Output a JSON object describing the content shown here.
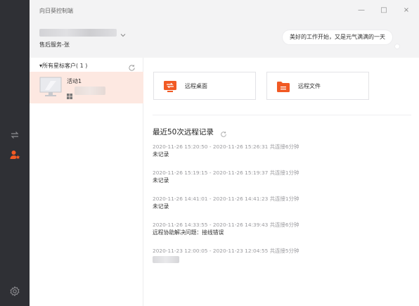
{
  "window": {
    "title": "向日葵控制端",
    "controls": {
      "minimize": "—",
      "maximize": "□",
      "close": "×"
    }
  },
  "account": {
    "role": "售后服务-张",
    "greeting": "美好的工作开始，又是元气满满的一天"
  },
  "sidebar": {
    "icons": [
      "remote-connect-icon",
      "customer-group-icon",
      "settings-icon"
    ],
    "active_color": "#f15a24",
    "inactive_color": "#8c8c90"
  },
  "device_list": {
    "group_label": "▾所有星标客户( 1 )",
    "devices": [
      {
        "name": "活动1",
        "os_icon": "windows-icon"
      }
    ]
  },
  "actions": [
    {
      "label": "远程桌面",
      "icon": "remote-desktop-icon"
    },
    {
      "label": "远程文件",
      "icon": "remote-file-icon"
    }
  ],
  "records": {
    "title": "最近50次远程记录",
    "items": [
      {
        "time": "2020-11-26 15:20:50 - 2020-11-26 15:26:31 共连接6分钟",
        "note": "未记录"
      },
      {
        "time": "2020-11-26 15:19:15 - 2020-11-26 15:19:37 共连接1分钟",
        "note": "未记录"
      },
      {
        "time": "2020-11-26 14:41:01 - 2020-11-26 14:41:23 共连接1分钟",
        "note": "未记录"
      },
      {
        "time": "2020-11-26 14:33:55 - 2020-11-26 14:39:43 共连接6分钟",
        "note": "远程协助解决问题：接线错误"
      },
      {
        "time": "2020-11-23 12:00:05 - 2020-11-23 12:04:55 共连接5分钟",
        "note": ""
      }
    ]
  },
  "colors": {
    "accent": "#f15a24",
    "rail": "#2f3035",
    "header": "#f3f3f4",
    "selected_row": "#fde8e1"
  }
}
